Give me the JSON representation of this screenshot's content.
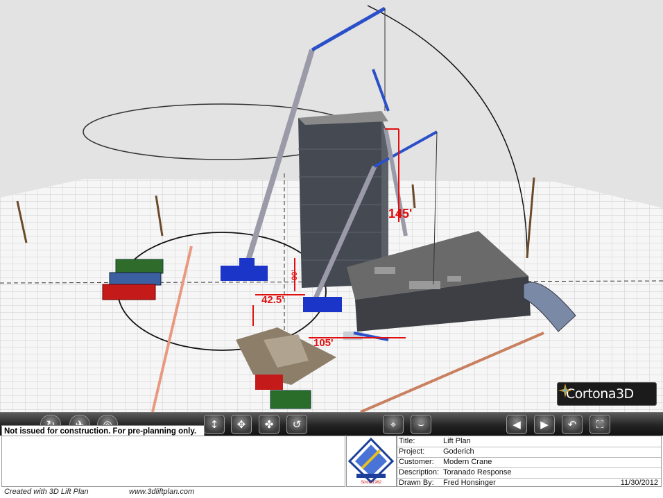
{
  "viewer": {
    "brand": "Cortona3D",
    "scene_labels": {
      "height_label": "145'",
      "radius_label_1": "42.5'",
      "radius_label_2": "105'",
      "height_label_small": "90'"
    },
    "toolbar": {
      "left_buttons": [
        "walk",
        "fly",
        "study"
      ],
      "center_buttons": [
        "plan",
        "pan",
        "turn",
        "roll"
      ],
      "right_buttons": [
        "goto",
        "align"
      ],
      "nav_buttons": [
        "previous-viewpoint",
        "next-viewpoint",
        "restore",
        "fit"
      ]
    }
  },
  "disclaimer": "Not issued for construction. For pre-planning only.",
  "titleblock": {
    "rows": [
      {
        "label": "Title:",
        "value": "Lift Plan"
      },
      {
        "label": "Project:",
        "value": "Goderich"
      },
      {
        "label": "Customer:",
        "value": "Modern Crane"
      },
      {
        "label": "Description:",
        "value": "Toranado Response"
      },
      {
        "label": "Drawn By:",
        "value": "Fred Honsinger"
      }
    ],
    "date": "11/30/2012"
  },
  "company_logo": {
    "text": "Since 1962"
  },
  "footer": {
    "created_with": "Created with 3D Lift Plan",
    "url": "www.3dliftplan.com"
  },
  "colors": {
    "crane_blue": "#1a35c8",
    "dimension_red": "#e01010",
    "building_gray": "#4a4d52",
    "ground": "#f4f4f4"
  }
}
